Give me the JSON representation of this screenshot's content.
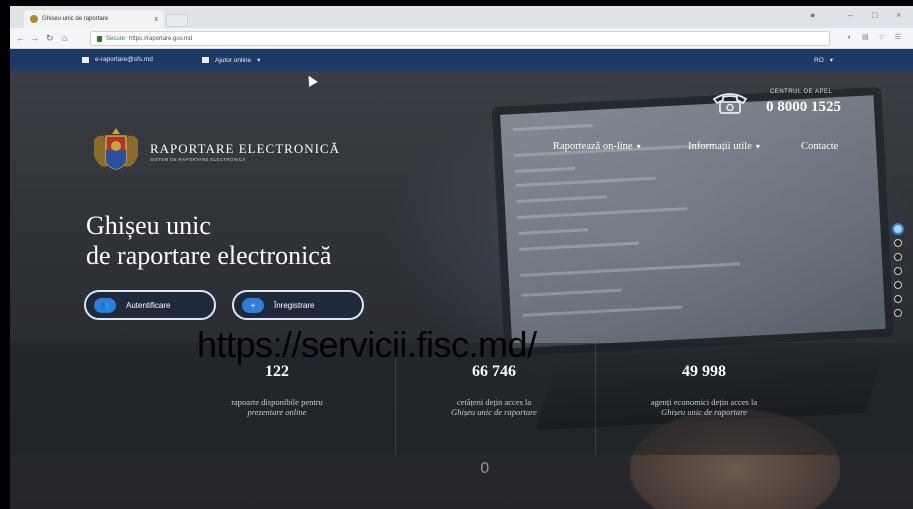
{
  "browser": {
    "tab_title": "Ghiseu unic de raportare",
    "tab_close": "x",
    "omnibox_secure": "Secure",
    "omnibox_url": "https://raportare.gov.md"
  },
  "topstrip": {
    "email": "e-raportare@sfs.md",
    "help": "Ajutor online",
    "language": "RO"
  },
  "call_center": {
    "label": "CENTRUL DE APEL",
    "number": "0 8000 1525"
  },
  "logo": {
    "title": "RAPORTARE ELECTRONICĂ",
    "subtitle": "SISTEM DE RAPORTARE ELECTRONICĂ"
  },
  "nav": {
    "items": [
      {
        "label": "Raportează on-line",
        "dropdown": true
      },
      {
        "label": "Informații utile",
        "dropdown": true
      },
      {
        "label": "Contacte",
        "dropdown": false
      }
    ]
  },
  "hero": {
    "line1": "Ghișeu unic",
    "line2": "de raportare electronică"
  },
  "buttons": {
    "login": "Autentificare",
    "register": "Înregistrare"
  },
  "overlay_url": "https://servicii.fisc.md/",
  "stats": [
    {
      "value": "122",
      "line1": "rapoarte disponibile pentru",
      "line2": "prezentare online"
    },
    {
      "value": "66 746",
      "line1": "cetățeni dețin acces la",
      "line2": "Ghișeu unic de raportare"
    },
    {
      "value": "49 998",
      "line1": "agenți economici dețin acces la",
      "line2": "Ghișeu unic de raportare"
    }
  ],
  "scroll_hint": "0",
  "colors": {
    "header_bar": "#1d3a66",
    "accent": "#2f7fd6"
  },
  "side_nav_dot_count": 7,
  "side_nav_active_index": 0
}
